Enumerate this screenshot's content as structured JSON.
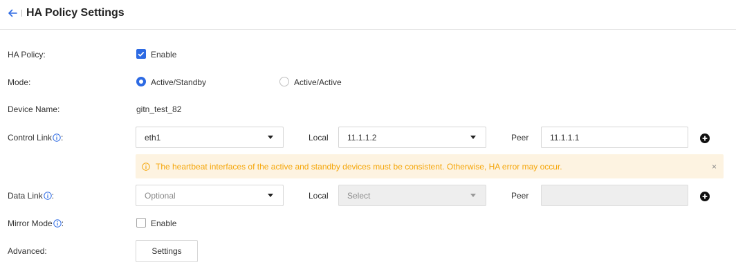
{
  "header": {
    "title": "HA Policy Settings"
  },
  "colors": {
    "accent": "#2d6ae3",
    "warning_text": "#f5a60a",
    "warning_bg": "#fdf3e1"
  },
  "ha_policy": {
    "label": "HA Policy:",
    "checkbox_label": "Enable",
    "checked": true
  },
  "mode": {
    "label": "Mode:",
    "options": [
      "Active/Standby",
      "Active/Active"
    ],
    "selected": "Active/Standby"
  },
  "device_name": {
    "label": "Device Name:",
    "value": "gitn_test_82"
  },
  "control_link": {
    "label": "Control Link",
    "colon": ":",
    "interface": "eth1",
    "local_label": "Local",
    "local_value": "11.1.1.2",
    "peer_label": "Peer",
    "peer_value": "11.1.1.1"
  },
  "alert": {
    "text": "The heartbeat interfaces of the active and standby devices must be consistent. Otherwise, HA error may occur.",
    "close": "×"
  },
  "data_link": {
    "label": "Data Link",
    "colon": ":",
    "interface_placeholder": "Optional",
    "local_label": "Local",
    "local_placeholder": "Select",
    "peer_label": "Peer",
    "peer_value": ""
  },
  "mirror_mode": {
    "label": "Mirror Mode",
    "colon": ":",
    "checkbox_label": "Enable",
    "checked": false
  },
  "advanced": {
    "label": "Advanced:",
    "button_label": "Settings"
  }
}
